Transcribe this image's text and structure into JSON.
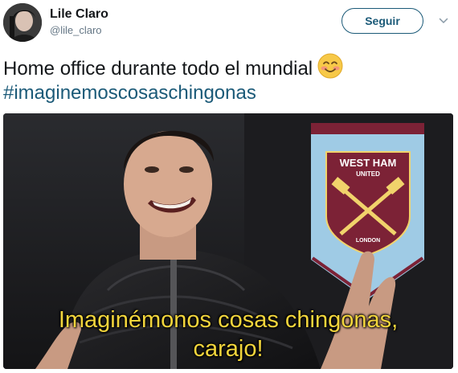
{
  "author": {
    "name": "Lile Claro",
    "handle": "@lile_claro"
  },
  "follow_button": {
    "label": "Seguir"
  },
  "menu_icon": "chevron-down-icon",
  "tweet": {
    "text": "Home office durante todo el mundial",
    "emoji": "smiling-face-with-blushing-cheeks",
    "hashtag": "#imaginemoscosaschingonas"
  },
  "media": {
    "subtitle_line1": "Imaginémonos cosas chingonas,",
    "subtitle_line2": "carajo!",
    "pennant_text_top": "WEST HAM",
    "pennant_text_mid": "UNITED",
    "pennant_text_bottom": "LONDON"
  },
  "colors": {
    "link": "#1b5a78",
    "text": "#14171a",
    "muted": "#657786",
    "subtitle": "#f2d53c",
    "claret": "#7c2236",
    "sky_blue": "#9fcbe5"
  }
}
